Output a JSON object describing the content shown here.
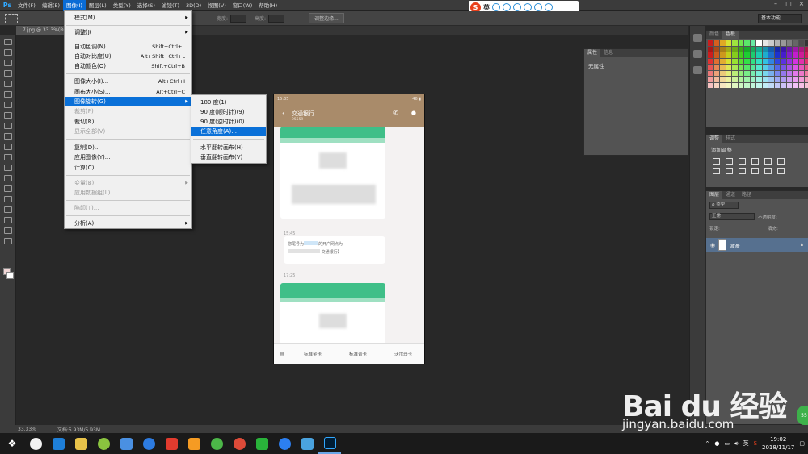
{
  "menubar": {
    "logo": "Ps",
    "items": [
      "文件(F)",
      "编辑(E)",
      "图像(I)",
      "图层(L)",
      "类型(Y)",
      "选择(S)",
      "滤镜(T)",
      "3D(D)",
      "视图(V)",
      "窗口(W)",
      "帮助(H)"
    ],
    "active_index": 2
  },
  "ime": {
    "brand": "S",
    "mode": "英"
  },
  "options": {
    "width_label": "宽度:",
    "height_label": "高度:",
    "refine_edge": "调整边缘...",
    "workspace": "基本功能"
  },
  "document": {
    "tab": "7.jpg @ 33.3%(RGB/8#)",
    "zoom": "33.33%",
    "doc_info": "文档:5.93M/5.93M"
  },
  "image_menu": {
    "items": [
      {
        "label": "模式(M)",
        "submenu": true
      },
      {
        "label": "调整(J)",
        "submenu": true
      },
      {
        "label": "自动色调(N)",
        "shortcut": "Shift+Ctrl+L"
      },
      {
        "label": "自动对比度(U)",
        "shortcut": "Alt+Shift+Ctrl+L"
      },
      {
        "label": "自动颜色(O)",
        "shortcut": "Shift+Ctrl+B"
      },
      {
        "label": "图像大小(I)...",
        "shortcut": "Alt+Ctrl+I"
      },
      {
        "label": "画布大小(S)...",
        "shortcut": "Alt+Ctrl+C"
      },
      {
        "label": "图像旋转(G)",
        "submenu": true,
        "highlighted": true
      },
      {
        "label": "裁剪(P)",
        "disabled": true
      },
      {
        "label": "裁切(R)..."
      },
      {
        "label": "显示全部(V)",
        "disabled": true
      },
      {
        "label": "复制(D)..."
      },
      {
        "label": "应用图像(Y)..."
      },
      {
        "label": "计算(C)..."
      },
      {
        "label": "变量(B)",
        "submenu": true,
        "disabled": true
      },
      {
        "label": "应用数据组(L)...",
        "disabled": true
      },
      {
        "label": "陷印(T)...",
        "disabled": true
      },
      {
        "label": "分析(A)",
        "submenu": true
      }
    ]
  },
  "rotate_submenu": {
    "items": [
      {
        "label": "180 度(1)"
      },
      {
        "label": "90 度(顺时针)(9)"
      },
      {
        "label": "90 度(逆时针)(0)"
      },
      {
        "label": "任意角度(A)...",
        "highlighted": true
      },
      {
        "label": "水平翻转画布(H)"
      },
      {
        "label": "垂直翻转画布(V)"
      }
    ]
  },
  "phone": {
    "status_time": "15:35",
    "status_right": "46 ▮",
    "title": "交通银行",
    "subtitle": "95559",
    "time1": "15:45",
    "message_line1": "您尾号为",
    "message_line1b": "的开户网点为",
    "message_line2": "交通银行】",
    "time2": "17:25",
    "tabs": [
      "标准金卡",
      "标准普卡",
      "沃尔玛卡"
    ]
  },
  "properties_panel": {
    "tabs": [
      "属性",
      "信息"
    ],
    "content": "无属性"
  },
  "swatches_panel": {
    "tabs": [
      "颜色",
      "色板"
    ]
  },
  "adjustments_panel": {
    "tabs": [
      "调整",
      "样式"
    ],
    "title": "添加调整"
  },
  "layers_panel": {
    "tabs": [
      "图层",
      "通道",
      "路径"
    ],
    "filter": "ρ 类型",
    "blend_mode": "正常",
    "opacity_label": "不透明度:",
    "lock_label": "锁定:",
    "fill_label": "填充:",
    "layer_name": "背景"
  },
  "taskbar": {
    "time": "19:02",
    "date": "2018/11/17",
    "ime": "英"
  },
  "watermark": {
    "brand": "Bai du 经验",
    "url": "jingyan.baidu.com",
    "badge": "55"
  },
  "colors": {
    "accent": "#0a70d8",
    "phone_header": "#a98b6a",
    "phone_green": "#3fbf88",
    "ps_blue": "#31a8ff"
  }
}
